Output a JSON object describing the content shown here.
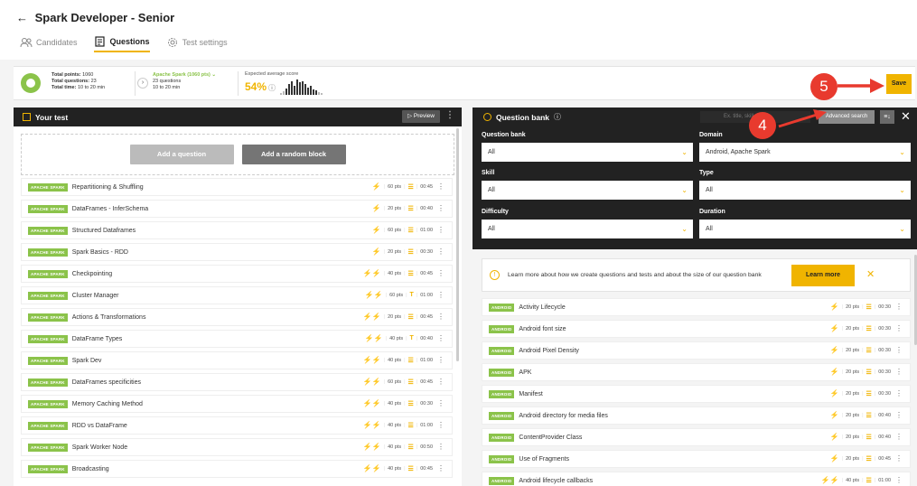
{
  "header": {
    "back_arrow": "←",
    "title": "Spark Developer - Senior",
    "tabs": [
      {
        "label": "Candidates",
        "icon": "users-icon",
        "active": false
      },
      {
        "label": "Questions",
        "icon": "questions-icon",
        "active": true
      },
      {
        "label": "Test settings",
        "icon": "gear-icon",
        "active": false
      }
    ]
  },
  "summary": {
    "total_points_label": "Total points:",
    "total_points": "1060",
    "total_questions_label": "Total questions:",
    "total_questions": "23",
    "total_time_label": "Total time:",
    "total_time": "10 to 20 min",
    "skill_title": "Apache Spark (1060 pts)",
    "skill_questions": "23 questions",
    "skill_time": "10 to 20 min",
    "expected_label": "Expected average score",
    "expected_value": "54%"
  },
  "save_label": "Save",
  "annotations": {
    "badge_4": "4",
    "badge_5": "5",
    "color": "#e83a2e"
  },
  "your_test": {
    "title": "Your test",
    "preview_label": "Preview",
    "add_question_label": "Add a question",
    "add_random_label": "Add a random block",
    "tag": "APACHE SPARK",
    "questions": [
      {
        "title": "Repartitioning & Shuffling",
        "points": "60 pts",
        "time": "00:45",
        "bolts": 1,
        "type": "list"
      },
      {
        "title": "DataFrames - InferSchema",
        "points": "20 pts",
        "time": "00:40",
        "bolts": 1,
        "type": "list"
      },
      {
        "title": "Structured Dataframes",
        "points": "60 pts",
        "time": "01:00",
        "bolts": 1,
        "type": "list"
      },
      {
        "title": "Spark Basics - RDD",
        "points": "20 pts",
        "time": "00:30",
        "bolts": 1,
        "type": "list"
      },
      {
        "title": "Checkpointing",
        "points": "40 pts",
        "time": "00:45",
        "bolts": 2,
        "type": "list"
      },
      {
        "title": "Cluster Manager",
        "points": "60 pts",
        "time": "01:00",
        "bolts": 2,
        "type": "text"
      },
      {
        "title": "Actions & Transformations",
        "points": "20 pts",
        "time": "00:45",
        "bolts": 2,
        "type": "list"
      },
      {
        "title": "DataFrame Types",
        "points": "40 pts",
        "time": "00:40",
        "bolts": 2,
        "type": "text"
      },
      {
        "title": "Spark Dev",
        "points": "40 pts",
        "time": "01:00",
        "bolts": 2,
        "type": "list"
      },
      {
        "title": "DataFrames specificities",
        "points": "60 pts",
        "time": "00:45",
        "bolts": 2,
        "type": "list"
      },
      {
        "title": "Memory Caching Method",
        "points": "40 pts",
        "time": "00:30",
        "bolts": 2,
        "type": "list"
      },
      {
        "title": "RDD vs DataFrame",
        "points": "40 pts",
        "time": "01:00",
        "bolts": 2,
        "type": "list"
      },
      {
        "title": "Spark Worker Node",
        "points": "40 pts",
        "time": "00:50",
        "bolts": 2,
        "type": "list"
      },
      {
        "title": "Broadcasting",
        "points": "40 pts",
        "time": "00:45",
        "bolts": 2,
        "type": "list"
      }
    ]
  },
  "question_bank": {
    "title": "Question bank",
    "search_placeholder": "Ex. title, skill, t",
    "advanced_search_label": "Advanced search",
    "filters": {
      "question_bank_label": "Question bank",
      "question_bank_value": "All",
      "domain_label": "Domain",
      "domain_value": "Android, Apache Spark",
      "skill_label": "Skill",
      "skill_value": "All",
      "type_label": "Type",
      "type_value": "All",
      "difficulty_label": "Difficulty",
      "difficulty_value": "All",
      "duration_label": "Duration",
      "duration_value": "All"
    },
    "info_text": "Learn more about how we create questions and tests and about the size of our question bank",
    "learn_more_label": "Learn more",
    "tag": "ANDROID",
    "questions": [
      {
        "title": "Activity Lifecycle",
        "points": "20 pts",
        "time": "00:30",
        "bolts": 1
      },
      {
        "title": "Android font size",
        "points": "20 pts",
        "time": "00:30",
        "bolts": 1
      },
      {
        "title": "Android Pixel Density",
        "points": "20 pts",
        "time": "00:30",
        "bolts": 1
      },
      {
        "title": "APK",
        "points": "20 pts",
        "time": "00:30",
        "bolts": 1
      },
      {
        "title": "Manifest",
        "points": "20 pts",
        "time": "00:30",
        "bolts": 1
      },
      {
        "title": "Android directory for media files",
        "points": "20 pts",
        "time": "00:40",
        "bolts": 1
      },
      {
        "title": "ContentProvider Class",
        "points": "20 pts",
        "time": "00:40",
        "bolts": 1
      },
      {
        "title": "Use of Fragments",
        "points": "20 pts",
        "time": "00:45",
        "bolts": 1
      },
      {
        "title": "Android lifecycle callbacks",
        "points": "40 pts",
        "time": "01:00",
        "bolts": 2
      }
    ]
  }
}
